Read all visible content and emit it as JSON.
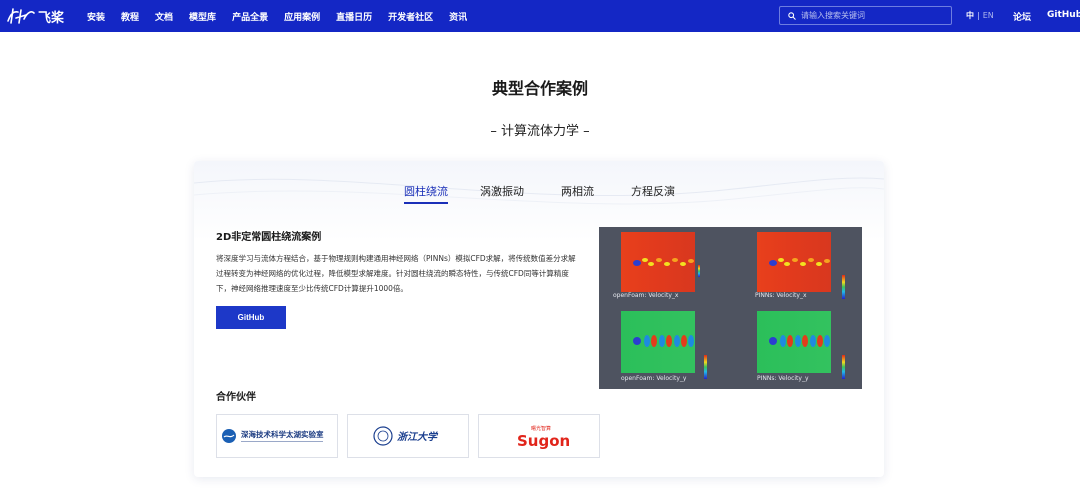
{
  "brand": {
    "logo_text": "飞桨"
  },
  "nav": {
    "items": [
      "安装",
      "教程",
      "文档",
      "模型库",
      "产品全景",
      "应用案例",
      "直播日历",
      "开发者社区",
      "资讯"
    ],
    "search_placeholder": "请输入搜索关键词",
    "lang_current": "中",
    "lang_sep": "|",
    "lang_alt": "EN",
    "forum": "论坛",
    "github": "GitHub"
  },
  "page": {
    "title": "典型合作案例",
    "section": "– 计算流体力学 –"
  },
  "tabs": [
    {
      "label": "圆柱绕流",
      "active": true
    },
    {
      "label": "涡激振动",
      "active": false
    },
    {
      "label": "两相流",
      "active": false
    },
    {
      "label": "方程反演",
      "active": false
    }
  ],
  "case": {
    "title": "2D非定常圆柱绕流案例",
    "description": "将深度学习与流体方程结合，基于物理规则构建通用神经网络（PINNs）模拟CFD求解，将传统数值差分求解过程转变为神经网络的优化过程，降低模型求解难度。针对圆柱绕流的瞬态特性，与传统CFD同等计算精度下，神经网络推理速度至少比传统CFD计算提升1000倍。",
    "button_label": "GitHub"
  },
  "figure": {
    "panels": [
      {
        "label": "openFoam: Velocity_x"
      },
      {
        "label": "PINNs: Velocity_x"
      },
      {
        "label": "openFoam: Velocity_y"
      },
      {
        "label": "PINNs: Velocity_y"
      }
    ]
  },
  "partners": {
    "title": "合作伙伴",
    "logos": [
      {
        "icon": "lab-logo-icon",
        "name": "深海技术科学太湖实验室"
      },
      {
        "icon": "zju-logo-icon",
        "name": "浙江大学"
      },
      {
        "icon": "sugon-logo-icon",
        "name": "Sugon",
        "subname": "曙光智算"
      }
    ]
  },
  "colors": {
    "nav_bg": "#1427c5",
    "accent": "#1a2fb8",
    "button": "#1d38c8",
    "sugon_red": "#e1251b"
  }
}
